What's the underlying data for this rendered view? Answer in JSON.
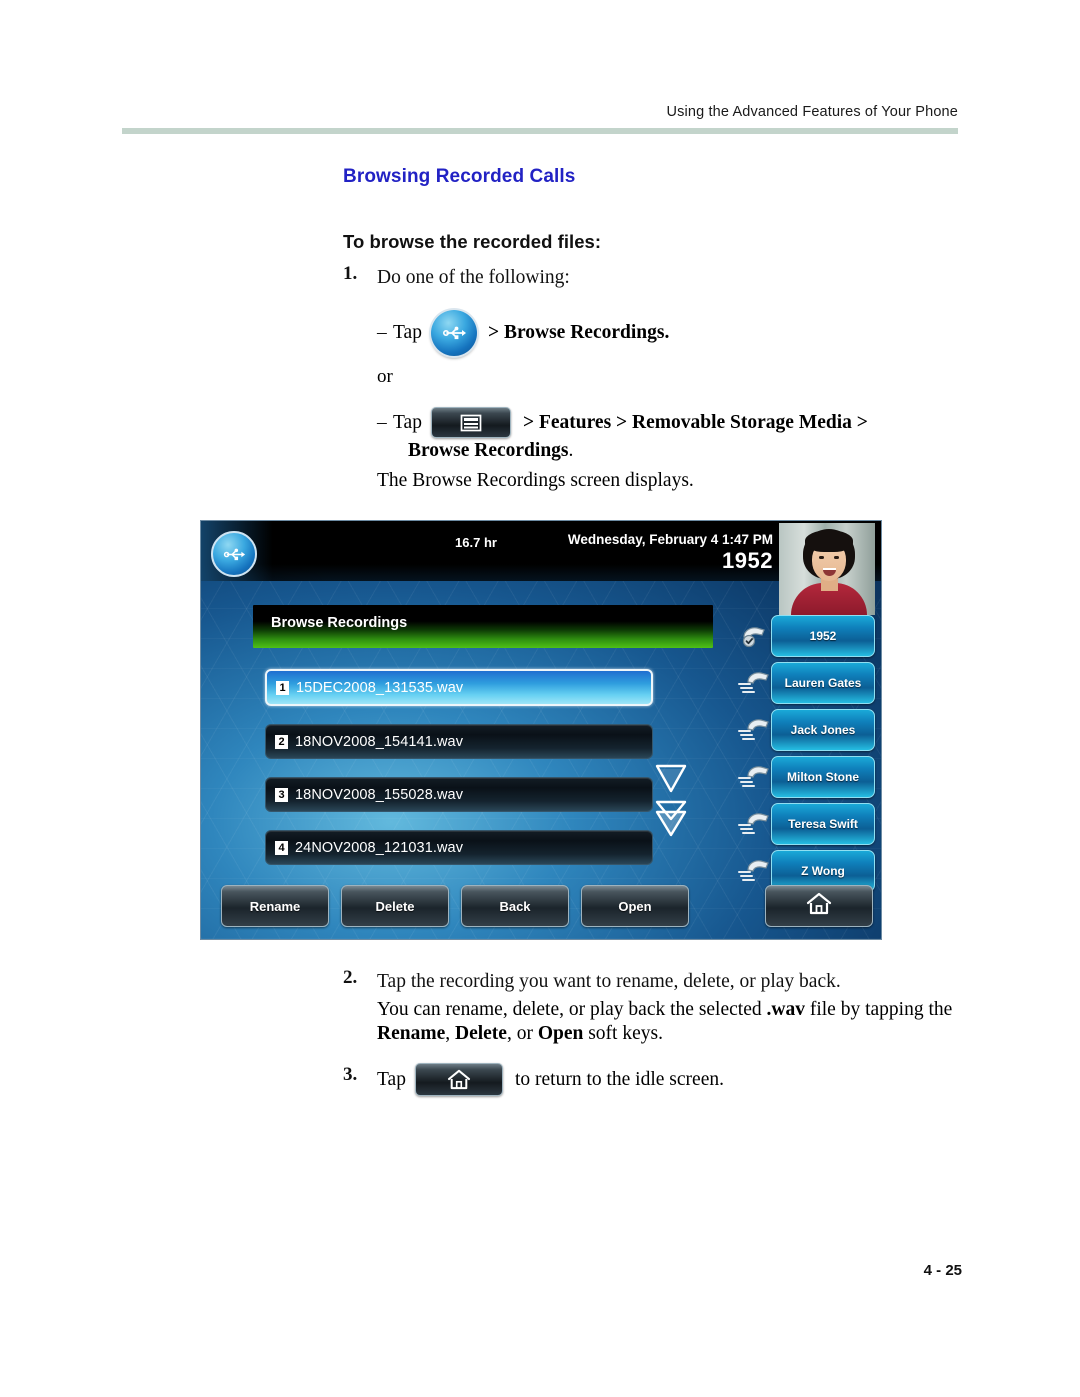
{
  "header": {
    "running_head": "Using the Advanced Features of Your Phone"
  },
  "section": {
    "title": "Browsing Recorded Calls",
    "task_title": "To browse the recorded files:"
  },
  "steps": {
    "step1": {
      "number": "1.",
      "text": "Do one of the following:",
      "bullet1": {
        "dash": "–",
        "tap": "Tap",
        "icon": "usb-icon",
        "after": "> Browse Recordings."
      },
      "or": "or",
      "bullet2": {
        "dash": "–",
        "tap": "Tap",
        "icon": "menu-icon",
        "after": "> Features > Removable Storage Media >",
        "continuation_bold": "Browse Recordings",
        "continuation_tail": "."
      },
      "result": "The Browse Recordings screen displays."
    },
    "step2": {
      "number": "2.",
      "text": "Tap the recording you want to rename, delete, or play back.",
      "body_line1_a": "You can rename, delete, or play back the selected ",
      "body_line1_bold": ".wav",
      "body_line1_b": " file by tapping the",
      "body_line2_bold1": "Rename",
      "body_line2_sep1": ", ",
      "body_line2_bold2": "Delete",
      "body_line2_sep2": ", or ",
      "body_line2_bold3": "Open",
      "body_line2_tail": " soft keys."
    },
    "step3": {
      "number": "3.",
      "tap": "Tap",
      "icon": "home-icon",
      "after": "to return to the idle screen."
    }
  },
  "phone_screen": {
    "usb_icon": "usb-icon",
    "capacity": "16.7 hr",
    "datetime": "Wednesday, February 4  1:47 PM",
    "my_extension": "1952",
    "avatar": "user-photo",
    "title_bar": "Browse Recordings",
    "files": [
      {
        "index": "1",
        "name": "15DEC2008_131535.wav",
        "selected": true
      },
      {
        "index": "2",
        "name": "18NOV2008_154141.wav",
        "selected": false
      },
      {
        "index": "3",
        "name": "18NOV2008_155028.wav",
        "selected": false
      },
      {
        "index": "4",
        "name": "24NOV2008_121031.wav",
        "selected": false
      }
    ],
    "scroll_icons": [
      "scroll-down-icon",
      "scroll-page-down-icon"
    ],
    "line_keys": [
      {
        "label": "1952",
        "icon": "handset-registered-icon"
      },
      {
        "label": "Lauren Gates",
        "icon": "handset-icon"
      },
      {
        "label": "Jack Jones",
        "icon": "handset-icon"
      },
      {
        "label": "Milton Stone",
        "icon": "handset-icon"
      },
      {
        "label": "Teresa Swift",
        "icon": "handset-icon"
      },
      {
        "label": "Z Wong",
        "icon": "handset-icon"
      }
    ],
    "soft_keys": [
      "Rename",
      "Delete",
      "Back",
      "Open"
    ],
    "home_key_icon": "home-icon"
  },
  "footer": {
    "page_number": "4 - 25"
  },
  "colors": {
    "heading_blue": "#2222c4",
    "rule_green": "#c3d4cb",
    "title_bar_green": "#4fc116",
    "line_key_blue": "#0f7fba"
  }
}
